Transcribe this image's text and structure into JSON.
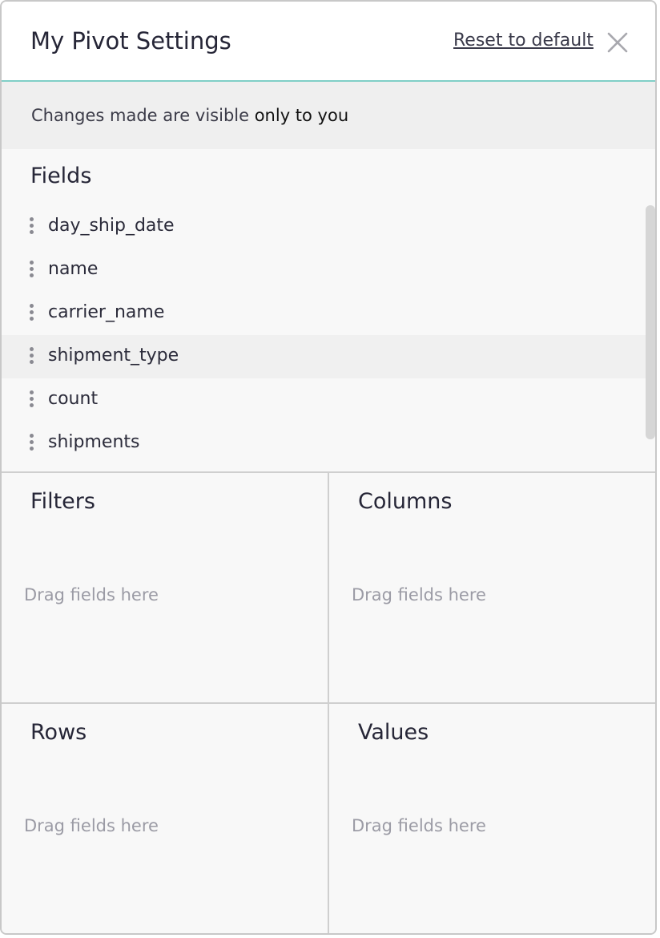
{
  "header": {
    "title": "My Pivot Settings",
    "reset_label": "Reset to default"
  },
  "notice": {
    "prefix": "Changes made are visible ",
    "emphasis": "only to you"
  },
  "fields": {
    "title": "Fields",
    "items": [
      {
        "label": "day_ship_date"
      },
      {
        "label": "name"
      },
      {
        "label": "carrier_name"
      },
      {
        "label": "shipment_type"
      },
      {
        "label": "count"
      },
      {
        "label": "shipments"
      }
    ]
  },
  "zones": {
    "filters": {
      "title": "Filters",
      "placeholder": "Drag fields here"
    },
    "columns": {
      "title": "Columns",
      "placeholder": "Drag fields here"
    },
    "rows": {
      "title": "Rows",
      "placeholder": "Drag fields here"
    },
    "values": {
      "title": "Values",
      "placeholder": "Drag fields here"
    }
  },
  "icons": {
    "close": "close-icon",
    "drag": "drag-handle-icon"
  },
  "colors": {
    "header_border": "#80cfc7",
    "notice_bg": "#efefef",
    "panel_bg": "#f8f8f8"
  }
}
